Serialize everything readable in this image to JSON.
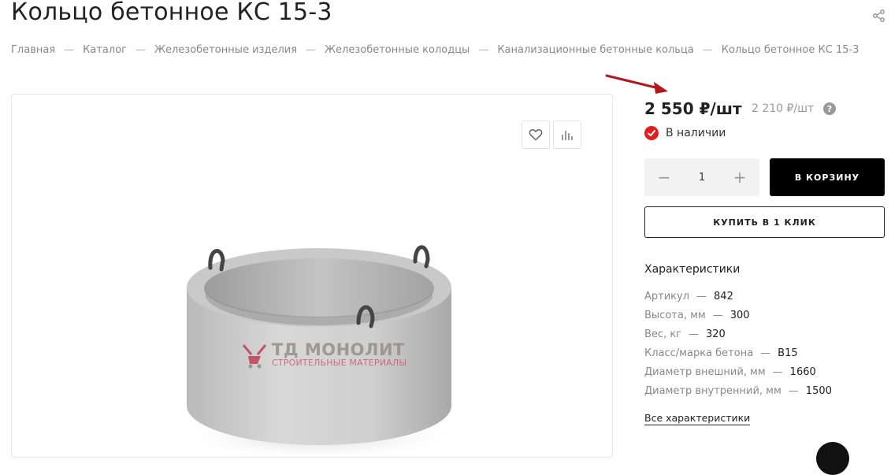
{
  "page": {
    "title": "Кольцо бетонное КС 15-3"
  },
  "breadcrumb": [
    "Главная",
    "Каталог",
    "Железобетонные изделия",
    "Железобетонные колодцы",
    "Канализационные бетонные кольца",
    "Кольцо бетонное КС 15-3"
  ],
  "breadcrumb_separator": "—",
  "icons": {
    "share": "share-icon",
    "favorite": "heart-icon",
    "compare": "bar-chart-icon",
    "in_stock": "check-circle-icon",
    "help": "question-icon"
  },
  "watermark": {
    "name": "ТД МОНОЛИТ",
    "subtitle": "СТРОИТЕЛЬНЫЕ МАТЕРИАЛЫ"
  },
  "price": {
    "current": "2 550 ₽/шт",
    "old": "2 210 ₽/шт",
    "help": "?"
  },
  "stock": {
    "label": "В наличии"
  },
  "quantity": {
    "minus": "−",
    "value": "1",
    "plus": "+"
  },
  "buttons": {
    "cart": "В КОРЗИНУ",
    "one_click": "КУПИТЬ В 1 КЛИК"
  },
  "specs": {
    "title": "Характеристики",
    "dash": "—",
    "rows": [
      {
        "name": "Артикул",
        "value": "842"
      },
      {
        "name": "Высота, мм",
        "value": "300"
      },
      {
        "name": "Вес, кг",
        "value": "320"
      },
      {
        "name": "Класс/марка бетона",
        "value": "B15"
      },
      {
        "name": "Диаметр внешний, мм",
        "value": "1660"
      },
      {
        "name": "Диаметр внутренний, мм",
        "value": "1500"
      }
    ],
    "all_link": "Все характеристики"
  },
  "colors": {
    "accent_red": "#e02020",
    "arrow": "#b3161b",
    "cart_bg": "#000000"
  }
}
